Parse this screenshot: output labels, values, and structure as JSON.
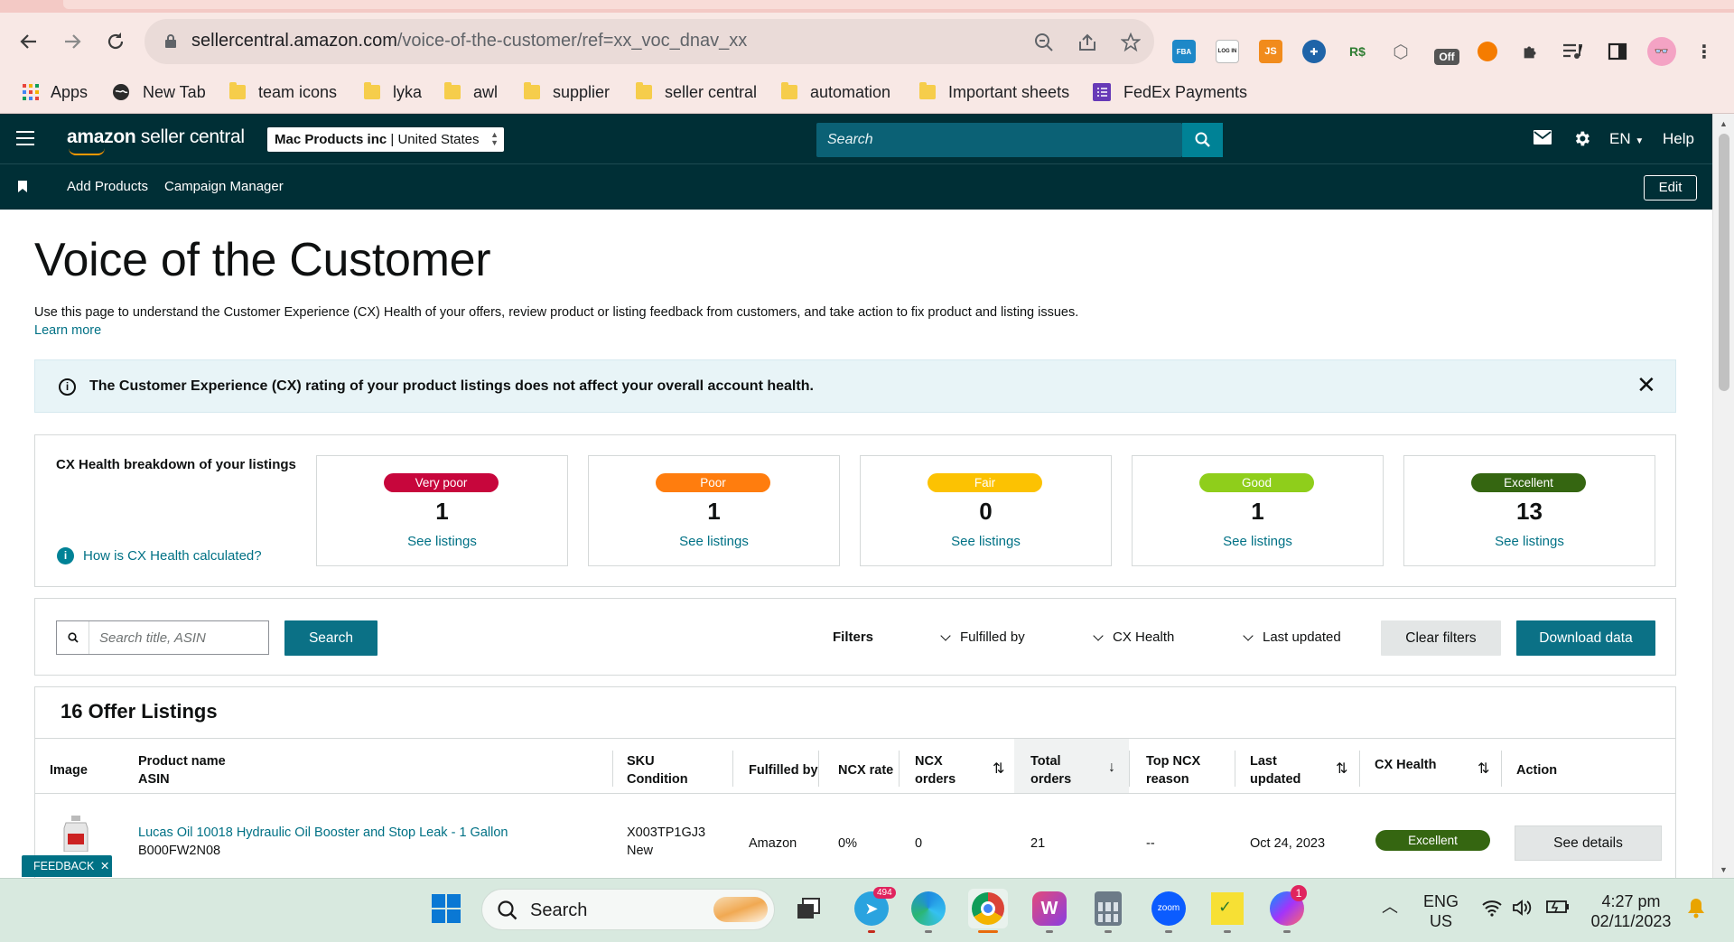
{
  "browser": {
    "url_domain": "sellercentral.amazon.com",
    "url_path": "/voice-of-the-customer/ref=xx_voc_dnav_xx",
    "extensions": [
      {
        "icon": "fba-icon",
        "label": "FBA",
        "color": "#1e88c8"
      },
      {
        "icon": "login-icon",
        "label": "LOG IN",
        "color": "#ffffff"
      },
      {
        "icon": "js-icon",
        "label": "JS",
        "color": "#f18b1c"
      },
      {
        "icon": "gamepad-icon",
        "label": "",
        "color": "#1f64a8"
      },
      {
        "icon": "rs-icon",
        "label": "R$",
        "color": "#2e7d32"
      },
      {
        "icon": "cube-icon",
        "label": "",
        "color": "#9e9e9e"
      },
      {
        "icon": "off-icon",
        "label": "Off",
        "color": "#555555"
      },
      {
        "icon": "circle-ext-icon",
        "label": "",
        "color": "#f57c00"
      }
    ],
    "bookmarks": [
      {
        "icon": "apps-icon",
        "label": "Apps"
      },
      {
        "icon": "globe-icon",
        "label": "New Tab"
      },
      {
        "icon": "folder-icon",
        "label": "team icons"
      },
      {
        "icon": "folder-icon",
        "label": "lyka"
      },
      {
        "icon": "folder-icon",
        "label": "awl"
      },
      {
        "icon": "folder-icon",
        "label": "supplier"
      },
      {
        "icon": "folder-icon",
        "label": "seller central"
      },
      {
        "icon": "folder-icon",
        "label": "automation"
      },
      {
        "icon": "folder-icon",
        "label": "Important sheets"
      },
      {
        "icon": "form-icon",
        "label": "FedEx Payments"
      }
    ]
  },
  "header": {
    "logo_bold": "amazon",
    "logo_rest": " seller central",
    "store_name": "Mac Products inc",
    "store_region": "United States",
    "search_placeholder": "Search",
    "language": "EN",
    "help": "Help"
  },
  "nav": {
    "links": [
      "Add Products",
      "Campaign Manager"
    ],
    "edit": "Edit"
  },
  "page": {
    "title": "Voice of the Customer",
    "description": "Use this page to understand the Customer Experience (CX) Health of your offers, review product or listing feedback from customers, and take action to fix product and listing issues.",
    "learn_more": "Learn more",
    "banner": "The Customer Experience (CX) rating of your product listings does not affect your overall account health."
  },
  "cx_health": {
    "heading": "CX Health breakdown of your listings",
    "how_link": "How is CX Health calculated?",
    "cards": [
      {
        "label": "Very poor",
        "count": "1",
        "link": "See listings",
        "color": "#c7063c"
      },
      {
        "label": "Poor",
        "count": "1",
        "link": "See listings",
        "color": "#ff7d0e"
      },
      {
        "label": "Fair",
        "count": "0",
        "link": "See listings",
        "color": "#fcc202"
      },
      {
        "label": "Good",
        "count": "1",
        "link": "See listings",
        "color": "#8fce1b"
      },
      {
        "label": "Excellent",
        "count": "13",
        "link": "See listings",
        "color": "#356611"
      }
    ]
  },
  "filters": {
    "search_placeholder": "Search title, ASIN",
    "search_button": "Search",
    "label": "Filters",
    "dropdowns": [
      "Fulfilled by",
      "CX Health",
      "Last updated"
    ],
    "clear": "Clear filters",
    "download": "Download data"
  },
  "listings": {
    "title": "16 Offer Listings",
    "columns": {
      "image": "Image",
      "product_name": "Product name",
      "asin": "ASIN",
      "sku": "SKU",
      "condition": "Condition",
      "fulfilled_by": "Fulfilled by",
      "ncx_rate": "NCX rate",
      "ncx_orders_1": "NCX",
      "ncx_orders_2": "orders",
      "total_orders_1": "Total",
      "total_orders_2": "orders",
      "top_ncx_1": "Top NCX",
      "top_ncx_2": "reason",
      "last_updated_1": "Last",
      "last_updated_2": "updated",
      "cx_health": "CX Health",
      "action": "Action"
    },
    "rows": [
      {
        "product_name": "Lucas Oil 10018 Hydraulic Oil Booster and Stop Leak - 1 Gallon",
        "asin": "B000FW2N08",
        "sku": "X003TP1GJ3",
        "condition": "New",
        "fulfilled_by": "Amazon",
        "ncx_rate": "0%",
        "ncx_orders": "0",
        "total_orders": "21",
        "top_ncx_reason": "--",
        "last_updated": "Oct 24, 2023",
        "cx_health": "Excellent",
        "action": "See details"
      }
    ]
  },
  "feedback": "FEEDBACK",
  "taskbar": {
    "search": "Search",
    "lang_1": "ENG",
    "lang_2": "US",
    "time": "4:27 pm",
    "date": "02/11/2023",
    "telegram_badge": "494",
    "messenger_badge": "1"
  }
}
